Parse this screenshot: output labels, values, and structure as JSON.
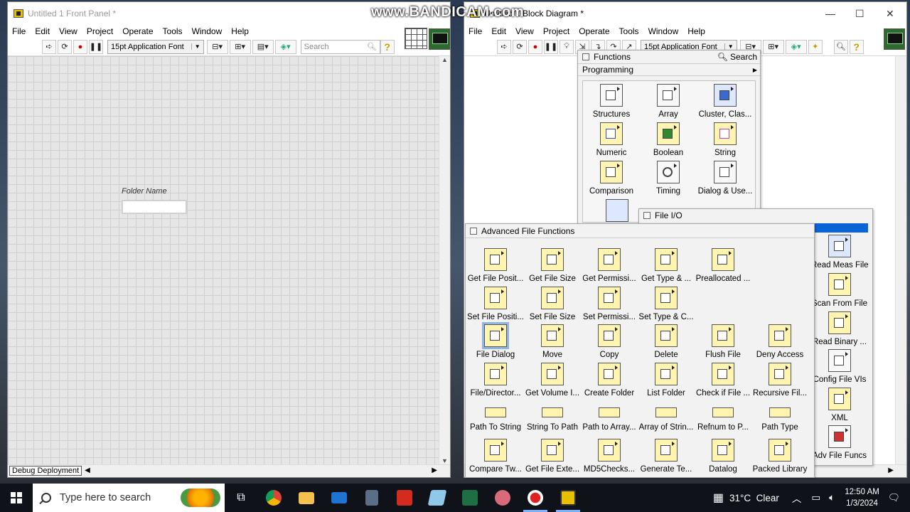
{
  "watermark": "www.BANDICAM.com",
  "front_panel": {
    "title": "Untitled 1 Front Panel *",
    "menu": [
      "File",
      "Edit",
      "View",
      "Project",
      "Operate",
      "Tools",
      "Window",
      "Help"
    ],
    "font": "15pt Application Font",
    "search_placeholder": "Search",
    "control_label": "Folder Name",
    "status_label": "Debug Deployment"
  },
  "block_diagram": {
    "title": "Untitled 1 Block Diagram *",
    "menu": [
      "File",
      "Edit",
      "View",
      "Project",
      "Operate",
      "Tools",
      "Window",
      "Help"
    ],
    "font": "15pt Application Font"
  },
  "functions_palette": {
    "title": "Functions",
    "search": "Search",
    "category": "Programming",
    "items": [
      {
        "label": "Structures",
        "icon": "structures-icon"
      },
      {
        "label": "Array",
        "icon": "array-icon"
      },
      {
        "label": "Cluster, Clas...",
        "icon": "cluster-icon"
      },
      {
        "label": "Numeric",
        "icon": "numeric-icon"
      },
      {
        "label": "Boolean",
        "icon": "boolean-icon"
      },
      {
        "label": "String",
        "icon": "string-icon"
      },
      {
        "label": "Comparison",
        "icon": "comparison-icon"
      },
      {
        "label": "Timing",
        "icon": "timing-icon"
      },
      {
        "label": "Dialog & Use...",
        "icon": "dialog-icon"
      }
    ]
  },
  "file_io_palette": {
    "title": "File I/O",
    "items": [
      {
        "label": "Read Meas File"
      },
      {
        "label": "Scan From File"
      },
      {
        "label": "Read Binary ..."
      },
      {
        "label": "Config File VIs"
      },
      {
        "label": "XML"
      },
      {
        "label": "Adv File Funcs"
      }
    ]
  },
  "advanced_palette": {
    "title": "Advanced File Functions",
    "items": [
      "Get File Posit...",
      "Get File Size",
      "Get Permissi...",
      "Get Type & ...",
      "Preallocated ...",
      "",
      "Set File Positi...",
      "Set File Size",
      "Set Permissi...",
      "Set Type & C...",
      "",
      "",
      "File Dialog",
      "Move",
      "Copy",
      "Delete",
      "Flush File",
      "Deny Access",
      "File/Director...",
      "Get Volume I...",
      "Create Folder",
      "List Folder",
      "Check if File ...",
      "Recursive Fil...",
      "Path To String",
      "String To Path",
      "Path to Array...",
      "Array of Strin...",
      "Refnum to P...",
      "Path Type",
      "Compare Tw...",
      "Get File Exte...",
      "MD5Checks...",
      "Generate Te...",
      "Datalog",
      "Packed Library"
    ],
    "selected": "File Dialog"
  },
  "taskbar": {
    "search_placeholder": "Type here to search",
    "weather": "31°C  Clear",
    "time": "12:50 AM",
    "date": "1/3/2024"
  }
}
